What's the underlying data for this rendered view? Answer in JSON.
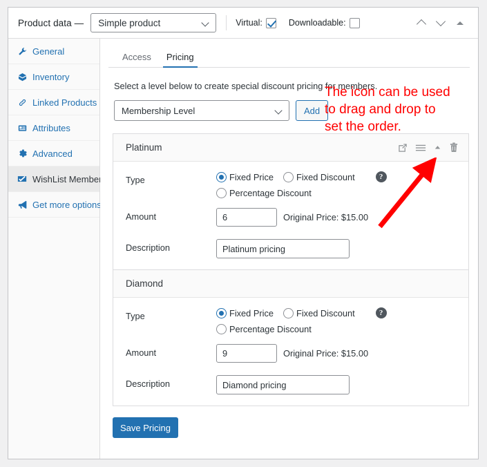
{
  "header": {
    "title": "Product data —",
    "product_type": "Simple product",
    "virtual_label": "Virtual:",
    "virtual_checked": true,
    "downloadable_label": "Downloadable:",
    "downloadable_checked": false,
    "actions": [
      "move-up-icon",
      "move-down-icon",
      "toggle-panel-icon"
    ]
  },
  "sidebar": {
    "items": [
      {
        "label": "General",
        "icon": "wrench-icon",
        "active": false
      },
      {
        "label": "Inventory",
        "icon": "box-icon",
        "active": false
      },
      {
        "label": "Linked Products",
        "icon": "link-icon",
        "active": false
      },
      {
        "label": "Attributes",
        "icon": "attributes-icon",
        "active": false
      },
      {
        "label": "Advanced",
        "icon": "gear-icon",
        "active": false
      },
      {
        "label": "WishList Member",
        "icon": "wishlist-check-icon",
        "active": true
      },
      {
        "label": "Get more options",
        "icon": "megaphone-icon",
        "active": false
      }
    ]
  },
  "main": {
    "tabs": [
      {
        "label": "Access",
        "active": false
      },
      {
        "label": "Pricing",
        "active": true
      }
    ],
    "intro": "Select a level below to create special discount pricing for members.",
    "level_select": {
      "value": "Membership Level"
    },
    "add_button": "Add",
    "save_button": "Save Pricing",
    "labels": {
      "type": "Type",
      "amount": "Amount",
      "description": "Description",
      "help": "?"
    },
    "type_options": [
      {
        "label": "Fixed Price"
      },
      {
        "label": "Fixed Discount"
      },
      {
        "label": "Percentage Discount"
      }
    ],
    "cards": [
      {
        "title": "Platinum",
        "icons": [
          "external-link-icon",
          "drag-handle-icon",
          "collapse-caret-icon",
          "trash-icon"
        ],
        "show_icons": true,
        "selected_type": "Fixed Price",
        "amount": "6",
        "original_price": "Original Price: $15.00",
        "description": "Platinum pricing"
      },
      {
        "title": "Diamond",
        "icons": [],
        "show_icons": false,
        "selected_type": "Fixed Price",
        "amount": "9",
        "original_price": "Original Price: $15.00",
        "description": "Diamond pricing"
      }
    ]
  },
  "annotation": {
    "line1": "The icon can be used",
    "line2": "to drag and drop to",
    "line3": "set the order.",
    "color": "#ff0000",
    "arrow": "red-arrow-pointing-to-drag-handle"
  },
  "colors": {
    "accent": "#2271b1",
    "annotation": "#ff0000",
    "panel_bg": "#ffffff",
    "page_bg": "#f0f0f1"
  }
}
